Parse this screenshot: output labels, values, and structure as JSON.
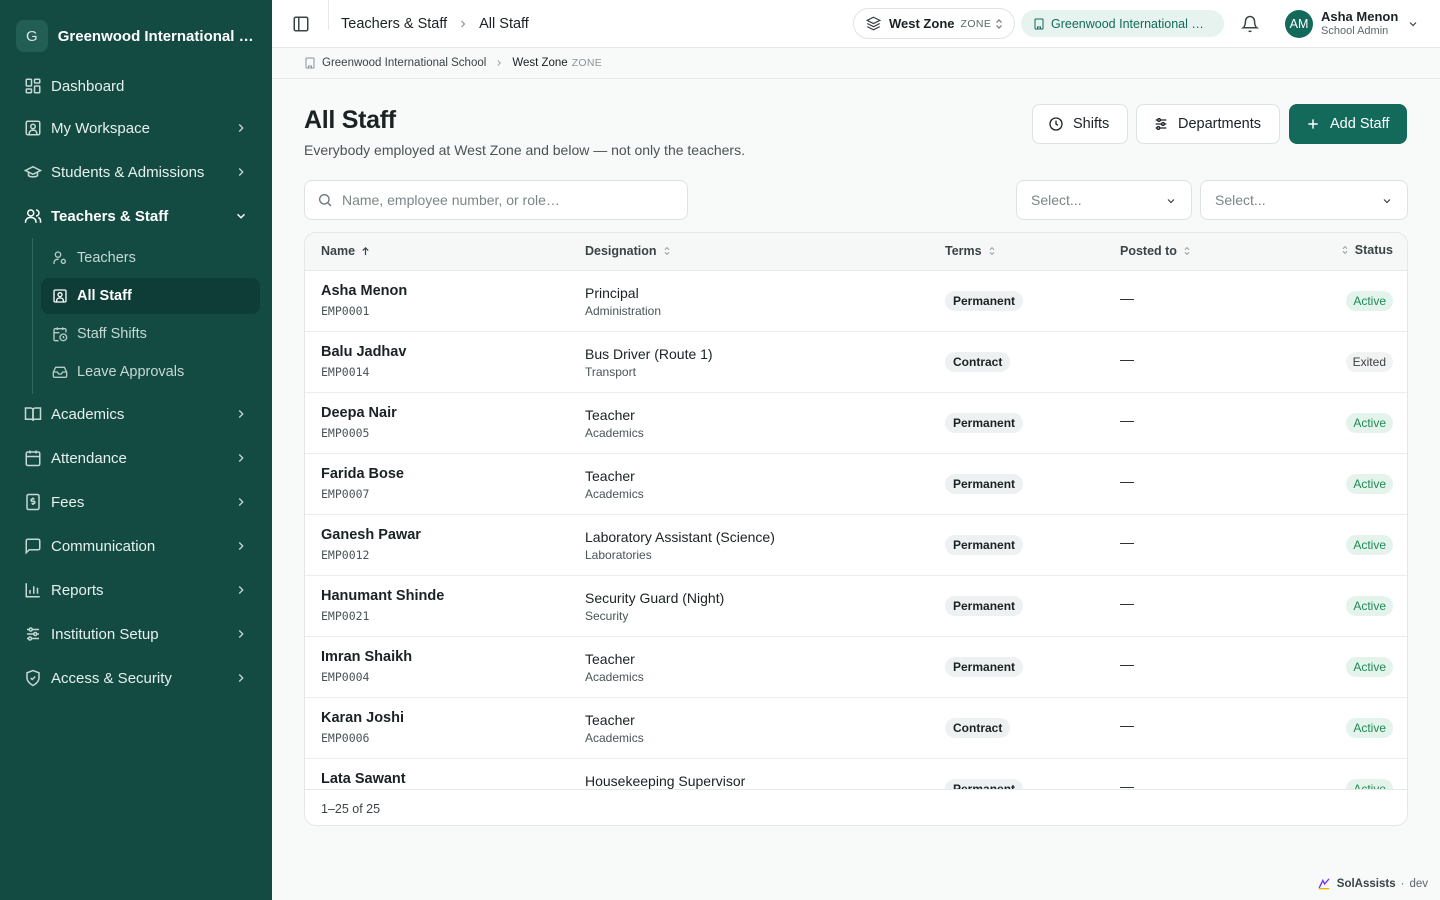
{
  "sidebar": {
    "logo_letter": "G",
    "title": "Greenwood International School",
    "items": [
      {
        "label": "Dashboard",
        "icon": "dashboard-icon"
      },
      {
        "label": "My Workspace",
        "icon": "workspace-icon"
      },
      {
        "label": "Students & Admissions",
        "icon": "graduation-cap-icon"
      },
      {
        "label": "Teachers & Staff",
        "icon": "users-icon",
        "expanded": true
      },
      {
        "label": "Academics",
        "icon": "book-icon"
      },
      {
        "label": "Attendance",
        "icon": "calendar-icon"
      },
      {
        "label": "Fees",
        "icon": "receipt-icon"
      },
      {
        "label": "Communication",
        "icon": "message-icon"
      },
      {
        "label": "Reports",
        "icon": "bar-chart-icon"
      },
      {
        "label": "Institution Setup",
        "icon": "sliders-icon"
      },
      {
        "label": "Access & Security",
        "icon": "shield-icon"
      }
    ],
    "subitems": [
      {
        "label": "Teachers",
        "icon": "teacher-icon"
      },
      {
        "label": "All Staff",
        "icon": "badge-icon",
        "active": true
      },
      {
        "label": "Staff Shifts",
        "icon": "calendar-clock-icon"
      },
      {
        "label": "Leave Approvals",
        "icon": "inbox-icon"
      }
    ]
  },
  "topbar": {
    "crumb_parent": "Teachers & Staff",
    "crumb_current": "All Staff",
    "zone_name": "West Zone",
    "zone_tag": "ZONE",
    "school_name": "Greenwood International School",
    "user_initials": "AM",
    "user_name": "Asha Menon",
    "user_role": "School Admin"
  },
  "subcrumb": {
    "school": "Greenwood International School",
    "zone": "West Zone",
    "zone_tag": "ZONE"
  },
  "page": {
    "title": "All Staff",
    "subtitle": "Everybody employed at West Zone and below — not only the teachers.",
    "shifts_label": "Shifts",
    "departments_label": "Departments",
    "add_label": "Add Staff"
  },
  "filters": {
    "search_placeholder": "Name, employee number, or role…",
    "select1_value": "Select...",
    "select2_value": "Select..."
  },
  "table": {
    "columns": [
      "Name",
      "Designation",
      "Terms",
      "Posted to",
      "Status"
    ],
    "sort": {
      "column": "Name",
      "direction": "asc"
    },
    "rows": [
      {
        "name": "Asha Menon",
        "emp": "EMP0001",
        "designation": "Principal",
        "department": "Administration",
        "terms": "Permanent",
        "posted": "—",
        "status": "Active"
      },
      {
        "name": "Balu Jadhav",
        "emp": "EMP0014",
        "designation": "Bus Driver (Route 1)",
        "department": "Transport",
        "terms": "Contract",
        "posted": "—",
        "status": "Exited"
      },
      {
        "name": "Deepa Nair",
        "emp": "EMP0005",
        "designation": "Teacher",
        "department": "Academics",
        "terms": "Permanent",
        "posted": "—",
        "status": "Active"
      },
      {
        "name": "Farida Bose",
        "emp": "EMP0007",
        "designation": "Teacher",
        "department": "Academics",
        "terms": "Permanent",
        "posted": "—",
        "status": "Active"
      },
      {
        "name": "Ganesh Pawar",
        "emp": "EMP0012",
        "designation": "Laboratory Assistant (Science)",
        "department": "Laboratories",
        "terms": "Permanent",
        "posted": "—",
        "status": "Active"
      },
      {
        "name": "Hanumant Shinde",
        "emp": "EMP0021",
        "designation": "Security Guard (Night)",
        "department": "Security",
        "terms": "Permanent",
        "posted": "—",
        "status": "Active"
      },
      {
        "name": "Imran Shaikh",
        "emp": "EMP0004",
        "designation": "Teacher",
        "department": "Academics",
        "terms": "Permanent",
        "posted": "—",
        "status": "Active"
      },
      {
        "name": "Karan Joshi",
        "emp": "EMP0006",
        "designation": "Teacher",
        "department": "Academics",
        "terms": "Contract",
        "posted": "—",
        "status": "Active"
      },
      {
        "name": "Lata Sawant",
        "emp": "",
        "designation": "Housekeeping Supervisor",
        "department": "",
        "terms": "Permanent",
        "posted": "—",
        "status": "Active"
      }
    ],
    "footer": "1–25 of 25"
  },
  "brand": {
    "name": "SolAssists",
    "env": "dev"
  },
  "colors": {
    "sidebar_bg": "#134b43",
    "accent": "#136a5a",
    "active_status": "#1f8a55"
  }
}
